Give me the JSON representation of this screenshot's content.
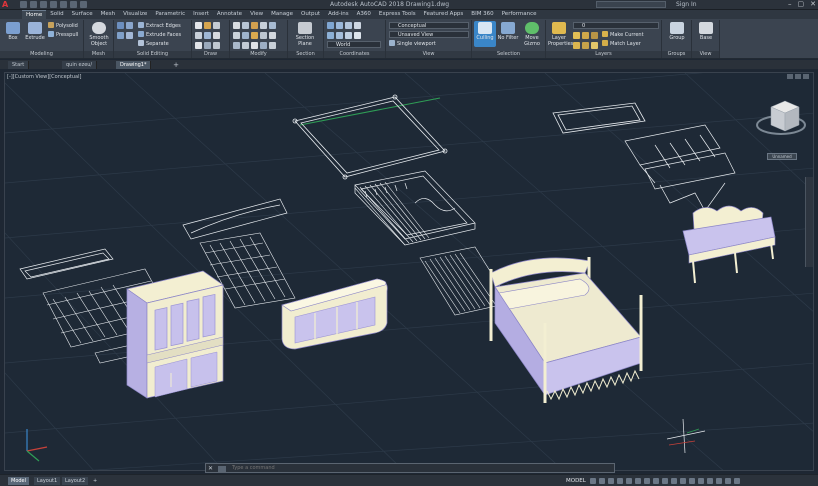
{
  "titlebar": {
    "app_logo": "A",
    "title": "Autodesk AutoCAD 2018   Drawing1.dwg",
    "search_placeholder": "",
    "signin": "Sign In",
    "window_controls": [
      "–",
      "▢",
      "✕"
    ]
  },
  "ribbon_tabs": [
    "Home",
    "Solid",
    "Surface",
    "Mesh",
    "Visualize",
    "Parametric",
    "Insert",
    "Annotate",
    "View",
    "Manage",
    "Output",
    "Add-ins",
    "A360",
    "Express Tools",
    "Featured Apps",
    "BIM 360",
    "Performance"
  ],
  "ribbon": {
    "modeling": {
      "label": "Modeling",
      "box": "Box",
      "extrude": "Extrude",
      "polysolid": "Polysolid",
      "presspull": "Presspull"
    },
    "mesh": {
      "label": "Mesh",
      "smooth_object": "Smooth Object"
    },
    "solid_editing": {
      "label": "Solid Editing",
      "extract_edges": "Extract Edges",
      "extrude_faces": "Extrude Faces",
      "separate": "Separate"
    },
    "draw": {
      "label": "Draw"
    },
    "modify": {
      "label": "Modify"
    },
    "section": {
      "label": "Section",
      "section_plane": "Section Plane"
    },
    "coordinates": {
      "label": "Coordinates",
      "world": "World"
    },
    "view": {
      "label": "View",
      "visual_style": "Conceptual",
      "saved_view": "Unsaved View",
      "viewport": "Single viewport"
    },
    "selection": {
      "label": "Selection",
      "culling": "Culling",
      "no_filter": "No Filter",
      "move_gizmo": "Move Gizmo"
    },
    "layers": {
      "label": "Layers",
      "layer_properties": "Layer Properties",
      "current_layer": "0",
      "make_current": "Make Current",
      "match_layer": "Match Layer"
    },
    "groups": {
      "label": "Groups",
      "group": "Group"
    },
    "view2": {
      "label": "View",
      "base": "Base"
    }
  },
  "file_tabs": {
    "start": "Start",
    "tab2": "quin ezeu/",
    "active": "Drawing1*",
    "add": "+"
  },
  "viewport": {
    "label": "[-][Custom View][Conceptual]",
    "viewcube_label": "Unnamed"
  },
  "cmdline": {
    "close": "✕",
    "prompt": "Type a command"
  },
  "statusbar": {
    "layouts": [
      "Model",
      "Layout1",
      "Layout2"
    ],
    "add": "+",
    "model_indicator": "MODEL"
  },
  "colors": {
    "viewport_bg": "#1e2936",
    "grid": "#2d3a49",
    "wireframe": "#e8ecf0",
    "solid_body": "#f3efd2",
    "solid_shade": "#a9a3e0",
    "accent": "#3a86c8"
  }
}
